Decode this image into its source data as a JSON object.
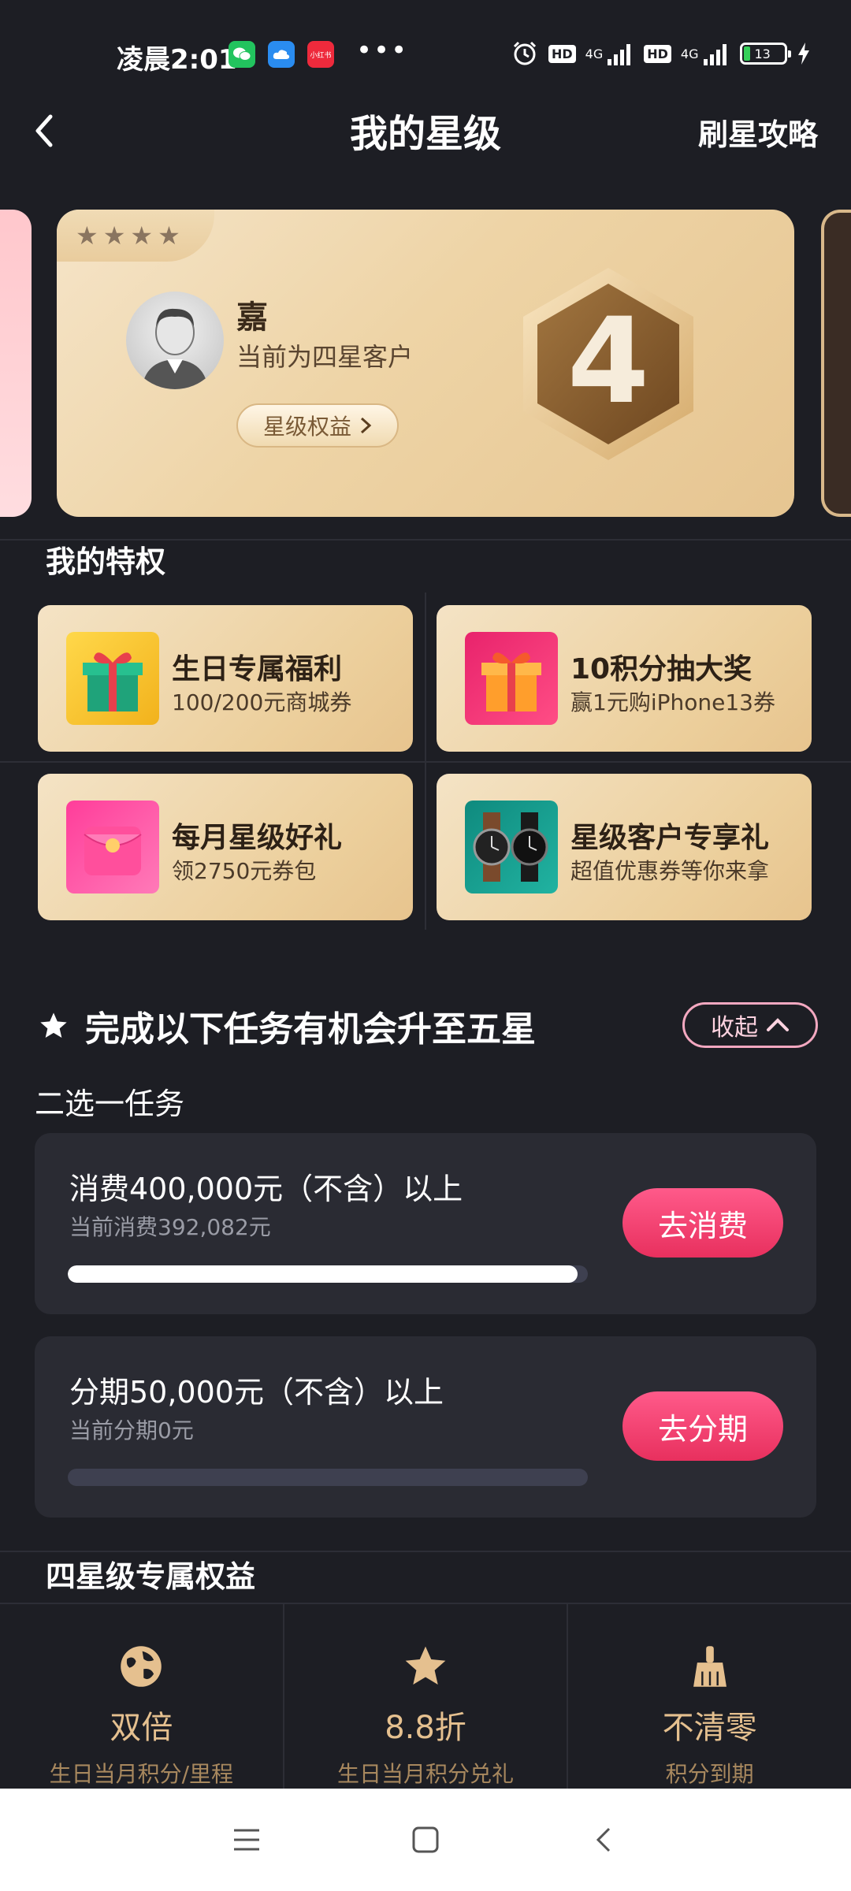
{
  "status_bar": {
    "time": "凌晨2:01",
    "app_icons": [
      "wechat-icon",
      "cloud-icon",
      "xiaohongshu-icon"
    ],
    "xiaohongshu_label": "小红书",
    "more": "•••",
    "hd1": "HD",
    "net1": "4G",
    "hd2": "HD",
    "net2": "4G",
    "battery": "13"
  },
  "header": {
    "title": "我的星级",
    "right_link": "刷星攻略"
  },
  "star_card": {
    "stars": 4,
    "username": "嘉",
    "level_desc": "当前为四星客户",
    "benefit_button": "星级权益",
    "level_badge": "4",
    "colors": {
      "gold": "#e9cc9d",
      "badge": "#8c5e2a"
    }
  },
  "privileges": {
    "title": "我的特权",
    "items": [
      {
        "title": "生日专属福利",
        "subtitle": "100/200元商城券",
        "icon": "gift-box-icon"
      },
      {
        "title": "10积分抽大奖",
        "subtitle": "赢1元购iPhone13券",
        "icon": "gift-box-icon"
      },
      {
        "title": "每月星级好礼",
        "subtitle": "领2750元券包",
        "icon": "red-envelope-icon"
      },
      {
        "title": "星级客户专享礼",
        "subtitle": "超值优惠券等你来拿",
        "icon": "watch-icon"
      }
    ]
  },
  "tasks": {
    "heading": "完成以下任务有机会升至五星",
    "collapse_label": "收起",
    "choose_label": "二选一任务",
    "items": [
      {
        "name": "消费400,000元（不含）以上",
        "current": "当前消费392,082元",
        "button": "去消费",
        "progress": 0.98
      },
      {
        "name": "分期50,000元（不含）以上",
        "current": "当前分期0元",
        "button": "去分期",
        "progress": 0
      }
    ],
    "accent": "#ff5a8a"
  },
  "exclusive": {
    "title": "四星级专属权益",
    "items": [
      {
        "value": "双倍",
        "desc": "生日当月积分/里程",
        "icon": "globe-icon"
      },
      {
        "value": "8.8折",
        "desc": "生日当月积分兑礼",
        "icon": "star-icon"
      },
      {
        "value": "不清零",
        "desc": "积分到期",
        "icon": "broom-icon"
      }
    ]
  },
  "navbar": {
    "icons": [
      "menu-icon",
      "home-square-icon",
      "back-triangle-icon"
    ]
  }
}
